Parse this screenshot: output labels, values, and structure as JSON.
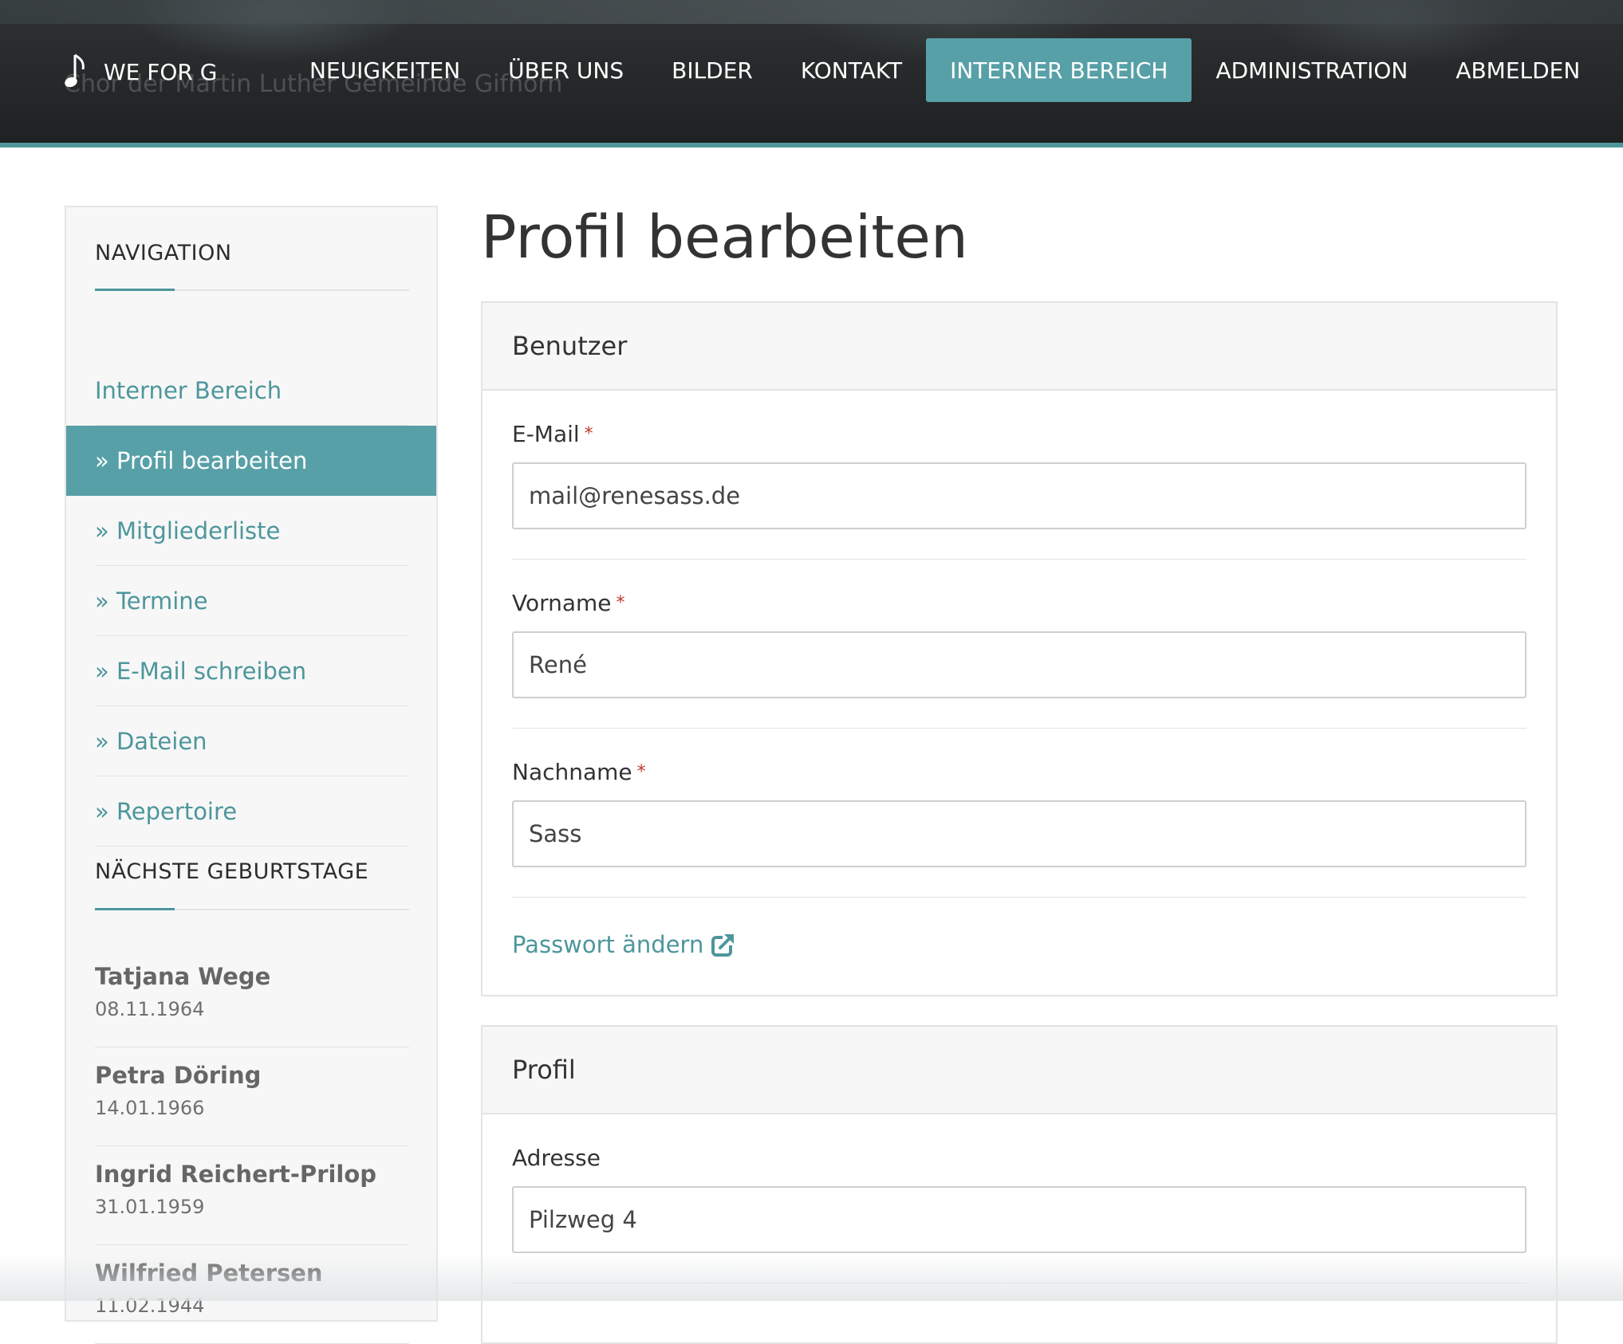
{
  "header": {
    "brand": "WE FOR G",
    "subtitle": "Chor der Martin Luther Gemeinde Gifhorn",
    "nav": [
      {
        "label": "NEUIGKEITEN",
        "active": false
      },
      {
        "label": "ÜBER UNS",
        "active": false
      },
      {
        "label": "BILDER",
        "active": false
      },
      {
        "label": "KONTAKT",
        "active": false
      },
      {
        "label": "INTERNER BEREICH",
        "active": true
      },
      {
        "label": "ADMINISTRATION",
        "active": false
      },
      {
        "label": "ABMELDEN",
        "active": false
      }
    ]
  },
  "sidebar": {
    "nav_heading": "NAVIGATION",
    "nav_items": [
      {
        "label": "Interner Bereich",
        "active": false
      },
      {
        "label": "» Profil bearbeiten",
        "active": true
      },
      {
        "label": "» Mitgliederliste",
        "active": false
      },
      {
        "label": "» Termine",
        "active": false
      },
      {
        "label": "» E-Mail schreiben",
        "active": false
      },
      {
        "label": "» Dateien",
        "active": false
      },
      {
        "label": "» Repertoire",
        "active": false
      }
    ],
    "birthdays_heading": "NÄCHSTE GEBURTSTAGE",
    "birthdays": [
      {
        "name": "Tatjana Wege",
        "date": "08.11.1964"
      },
      {
        "name": "Petra Döring",
        "date": "14.01.1966"
      },
      {
        "name": "Ingrid Reichert-Prilop",
        "date": "31.01.1959"
      },
      {
        "name": "Wilfried Petersen",
        "date": "11.02.1944"
      }
    ]
  },
  "main": {
    "title": "Profil bearbeiten",
    "user_panel": {
      "title": "Benutzer",
      "email_label": "E-Mail",
      "email_value": "mail@renesass.de",
      "firstname_label": "Vorname",
      "firstname_value": "René",
      "lastname_label": "Nachname",
      "lastname_value": "Sass",
      "required_mark": "*",
      "password_link": "Passwort ändern"
    },
    "profile_panel": {
      "title": "Profil",
      "address_label": "Adresse",
      "address_value": "Pilzweg 4"
    }
  },
  "colors": {
    "accent": "#58a0a7",
    "link": "#4d969c",
    "header_bg": "#262829",
    "required": "#c0392b"
  },
  "icons": [
    "music-note-icon",
    "external-link-icon"
  ]
}
